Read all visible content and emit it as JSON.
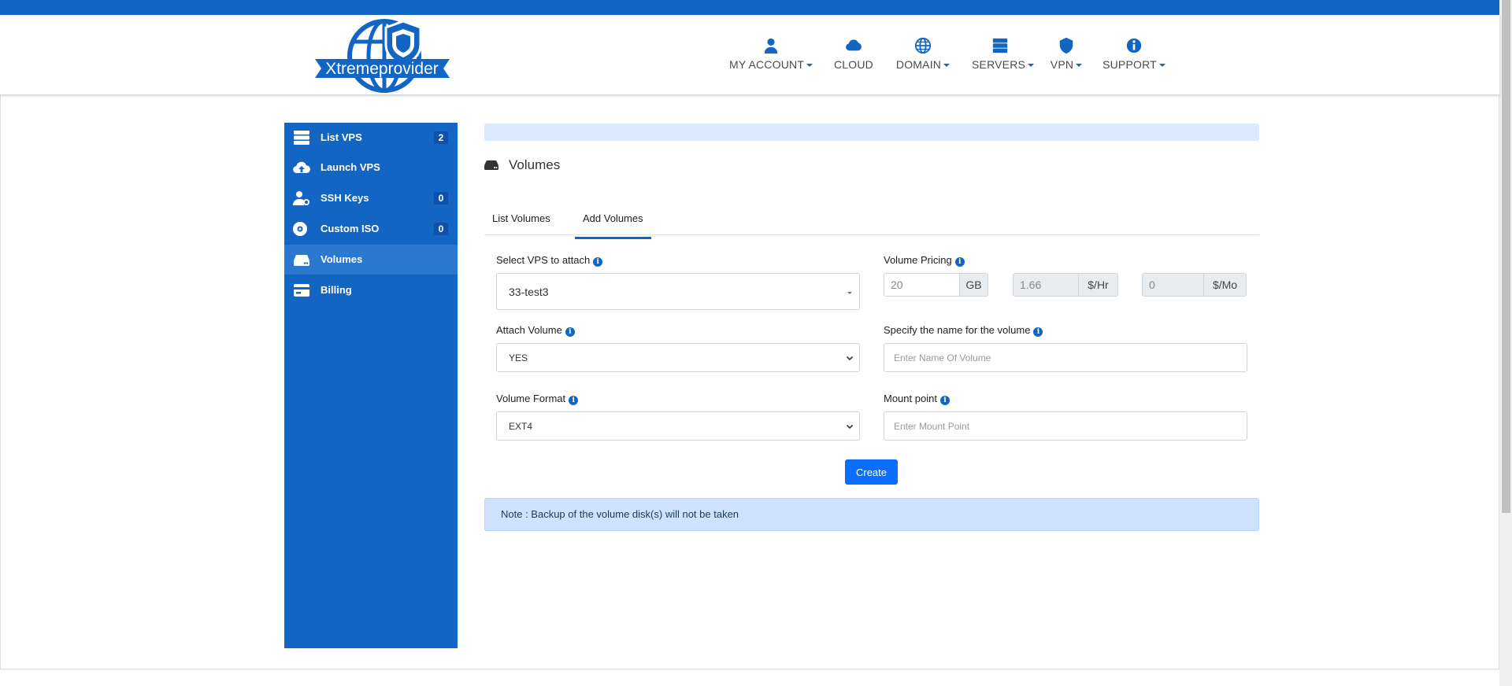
{
  "brand": {
    "logo_text": "Xtremeprovider"
  },
  "nav": {
    "items": [
      {
        "label": "MY ACCOUNT",
        "icon": "user-icon",
        "dropdown": true
      },
      {
        "label": "CLOUD",
        "icon": "cloud-icon",
        "dropdown": false
      },
      {
        "label": "DOMAIN",
        "icon": "globe-icon",
        "dropdown": true
      },
      {
        "label": "SERVERS",
        "icon": "server-icon",
        "dropdown": true
      },
      {
        "label": "VPN",
        "icon": "shield-icon",
        "dropdown": true
      },
      {
        "label": "SUPPORT",
        "icon": "info-icon",
        "dropdown": true
      }
    ]
  },
  "sidebar": {
    "items": [
      {
        "label": "List VPS",
        "icon": "server-list-icon",
        "badge": "2"
      },
      {
        "label": "Launch VPS",
        "icon": "cloud-upload-icon",
        "badge": ""
      },
      {
        "label": "SSH Keys",
        "icon": "user-key-icon",
        "badge": "0"
      },
      {
        "label": "Custom ISO",
        "icon": "disc-icon",
        "badge": "0"
      },
      {
        "label": "Volumes",
        "icon": "hdd-icon",
        "badge": "",
        "active": true
      },
      {
        "label": "Billing",
        "icon": "credit-card-icon",
        "badge": ""
      }
    ]
  },
  "page": {
    "title": "Volumes",
    "title_icon": "hdd-icon"
  },
  "tabs": [
    {
      "label": "List Volumes",
      "active": false
    },
    {
      "label": "Add Volumes",
      "active": true
    }
  ],
  "form": {
    "vps": {
      "label": "Select VPS to attach",
      "value": "33-test3"
    },
    "attach": {
      "label": "Attach Volume",
      "value": "YES"
    },
    "format": {
      "label": "Volume Format",
      "value": "EXT4"
    },
    "pricing": {
      "label": "Volume Pricing",
      "size": "20",
      "size_unit": "GB",
      "hourly": "1.66",
      "hourly_unit": "$/Hr",
      "monthly": "0",
      "monthly_unit": "$/Mo"
    },
    "name": {
      "label": "Specify the name for the volume",
      "placeholder": "Enter Name Of Volume"
    },
    "mount": {
      "label": "Mount point",
      "placeholder": "Enter Mount Point"
    },
    "create_label": "Create"
  },
  "note": "Note : Backup of the volume disk(s) will not be taken",
  "colors": {
    "primary": "#1265c2",
    "button": "#0d6efd",
    "note_bg": "#cfe2ff",
    "banner_bg": "#dbeafe"
  }
}
